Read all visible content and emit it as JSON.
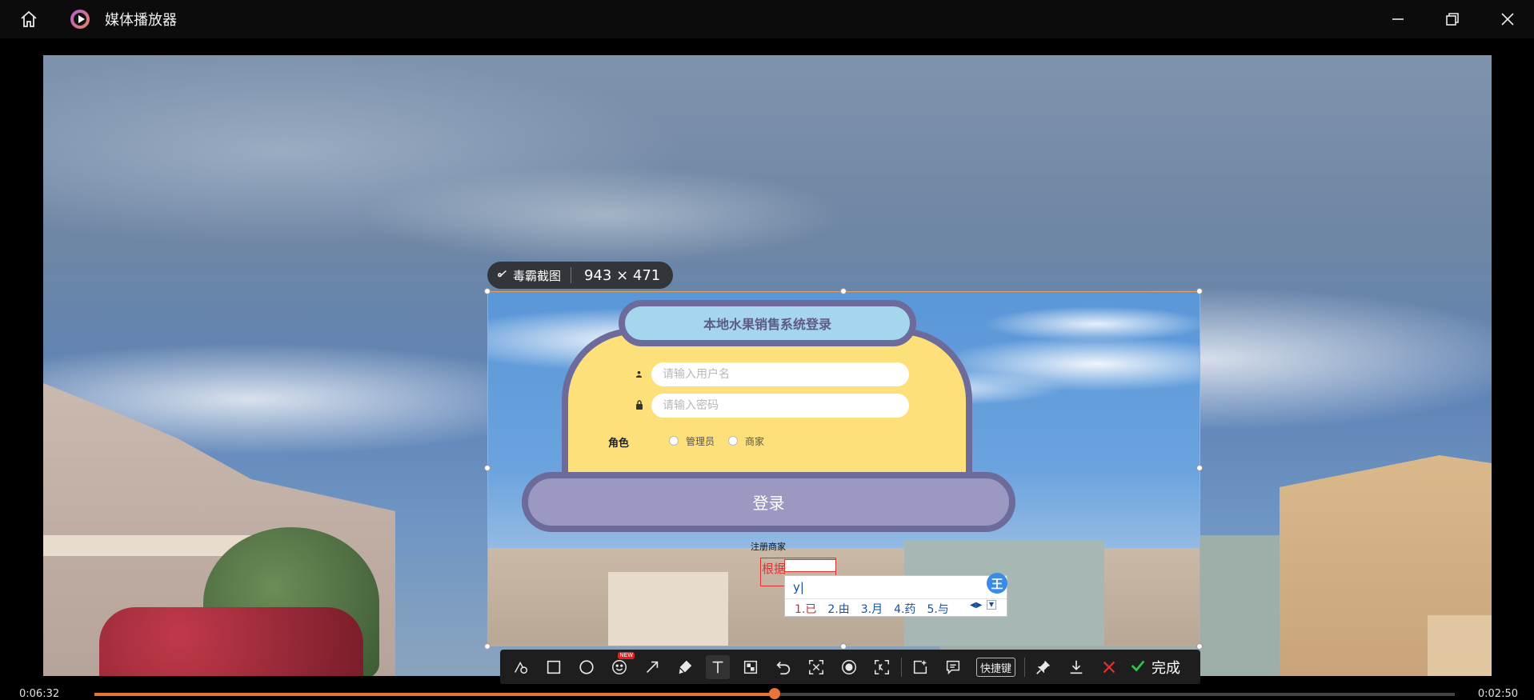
{
  "window": {
    "title": "媒体播放器"
  },
  "player": {
    "time_current": "0:06:32",
    "time_total": "0:02:50",
    "progress": 0.5
  },
  "capture": {
    "brand": "毒霸截图",
    "size": "943 × 471"
  },
  "login": {
    "title": "本地水果销售系统登录",
    "username_placeholder": "请输入用户名",
    "password_placeholder": "请输入密码",
    "role_label": "角色",
    "role_options": [
      "管理员",
      "商家"
    ],
    "login_button": "登录",
    "register_link": "注册商家"
  },
  "annotation": {
    "text": "根据"
  },
  "ime": {
    "input": "y|",
    "badge": "王",
    "candidates": [
      "1.已",
      "2.由",
      "3.月",
      "4.药",
      "5.与"
    ]
  },
  "toolbar": {
    "shortcut_label": "快捷键",
    "new_badge": "NEW",
    "done_label": "完成"
  },
  "colors": {
    "accent": "#e8743b",
    "card_yellow": "#fde07a",
    "card_border": "#6d6b9b",
    "cancel_red": "#e03030",
    "done_green": "#2ec24a"
  }
}
